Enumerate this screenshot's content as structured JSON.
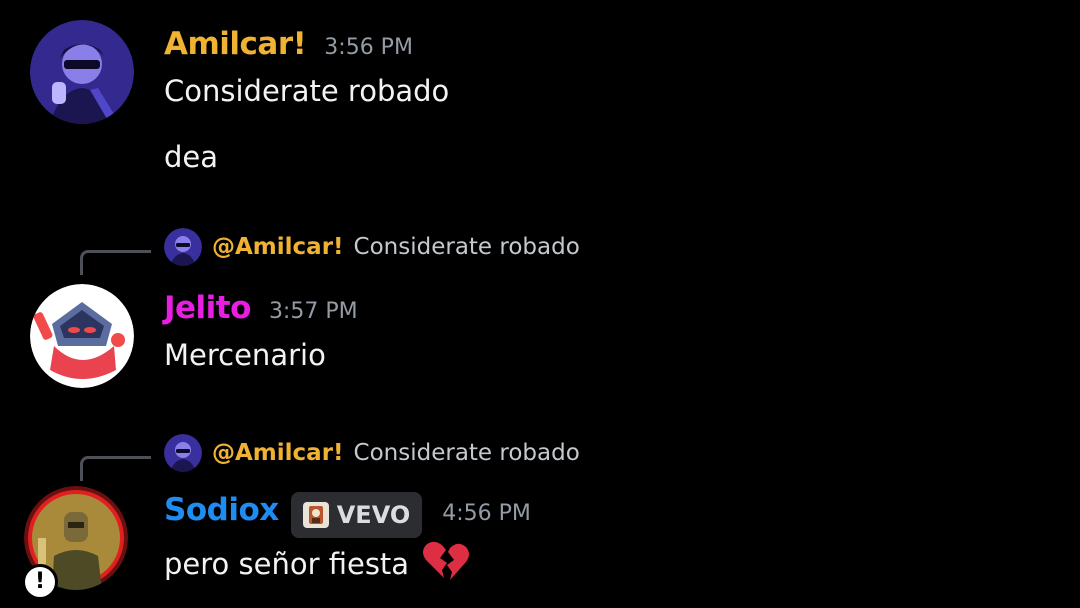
{
  "messages": [
    {
      "author": "Amilcar!",
      "author_color": "#f0b232",
      "timestamp": "3:56 PM",
      "lines": [
        "Considerate robado",
        "dea"
      ]
    },
    {
      "reply": {
        "mention": "@Amilcar!",
        "text": "Considerate robado"
      },
      "author": "Jelito",
      "author_color": "#e91ee3",
      "timestamp": "3:57 PM",
      "lines": [
        "Mercenario"
      ]
    },
    {
      "reply": {
        "mention": "@Amilcar!",
        "text": "Considerate robado"
      },
      "author": "Sodiox",
      "author_color": "#1e8cf0",
      "tag": "VEVO",
      "timestamp": "4:56 PM",
      "lines": [
        "pero señor fiesta"
      ],
      "emoji": "broken-heart-icon",
      "avatar_badge": "!"
    }
  ]
}
